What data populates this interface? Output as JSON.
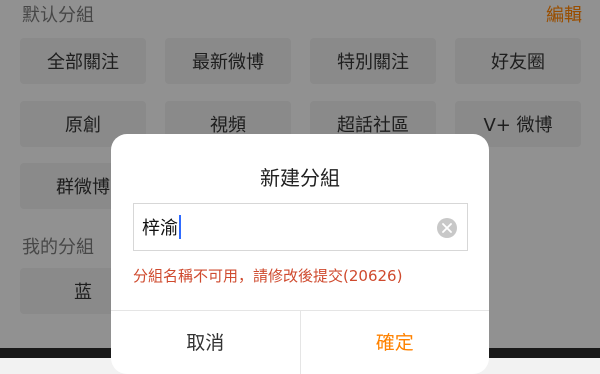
{
  "default_groups": {
    "title": "默认分組",
    "edit_label": "編輯",
    "chips": [
      "全部關注",
      "最新微博",
      "特別關注",
      "好友圈",
      "原創",
      "視頻",
      "超話社區",
      "V+ 微博",
      "群微博"
    ]
  },
  "my_groups": {
    "title": "我的分組",
    "chips": [
      "蓝"
    ]
  },
  "dialog": {
    "title": "新建分組",
    "input_value": "梓渝",
    "error": "分組名稱不可用，請修改後提交(20626)",
    "cancel_label": "取消",
    "confirm_label": "確定"
  },
  "colors": {
    "accent": "#ff8200",
    "error": "#cf4a2e",
    "caret": "#2f6bff"
  },
  "icons": {
    "clear": "clear-icon"
  }
}
